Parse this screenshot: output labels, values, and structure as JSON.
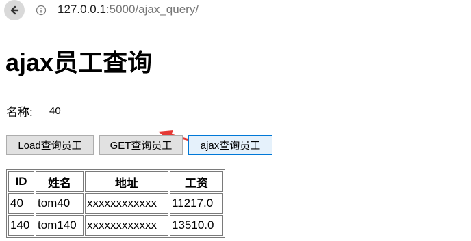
{
  "browser": {
    "back_icon": "arrow-left-icon",
    "info_icon": "info-circle-icon",
    "url_host": "127.0.0.1",
    "url_rest": ":5000/ajax_query/"
  },
  "page": {
    "title": "ajax员工查询",
    "name_label": "名称:",
    "name_value": "40",
    "buttons": {
      "load": "Load查询员工",
      "get": "GET查询员工",
      "ajax": "ajax查询员工"
    },
    "annotation_color": "#e53935"
  },
  "table": {
    "headers": [
      "ID",
      "姓名",
      "地址",
      "工资"
    ],
    "rows": [
      [
        "40",
        "tom40",
        "xxxxxxxxxxxx",
        "11217.0"
      ],
      [
        "140",
        "tom140",
        "xxxxxxxxxxxx",
        "13510.0"
      ]
    ]
  }
}
